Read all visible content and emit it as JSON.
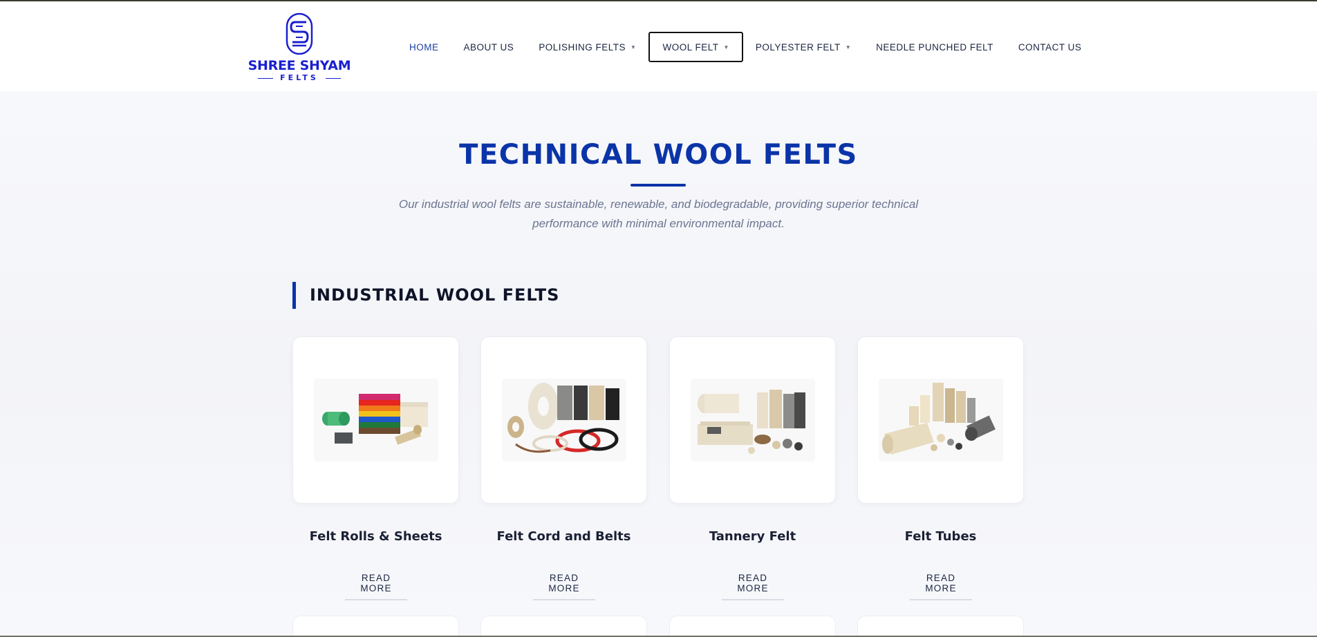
{
  "brand": {
    "name": "SHREE SHYAM",
    "tagline": "FELTS",
    "color": "#1a1fd0"
  },
  "nav": {
    "items": [
      {
        "label": "HOME",
        "active": true,
        "dropdown": false
      },
      {
        "label": "ABOUT US",
        "active": false,
        "dropdown": false
      },
      {
        "label": "POLISHING FELTS",
        "active": false,
        "dropdown": true
      },
      {
        "label": "WOOL FELT",
        "active": false,
        "dropdown": true,
        "focused": true
      },
      {
        "label": "POLYESTER FELT",
        "active": false,
        "dropdown": true
      },
      {
        "label": "NEEDLE PUNCHED FELT",
        "active": false,
        "dropdown": false
      },
      {
        "label": "CONTACT US",
        "active": false,
        "dropdown": false
      }
    ],
    "caret": "▼"
  },
  "hero": {
    "title": "TECHNICAL WOOL FELTS",
    "intro_line1": "Our industrial wool felts are sustainable, renewable, and biodegradable, providing superior technical",
    "intro_line2": "performance with minimal environmental impact."
  },
  "section": {
    "title": "INDUSTRIAL WOOL FELTS"
  },
  "products": [
    {
      "title": "Felt Rolls & Sheets",
      "cta": "READ MORE",
      "image": "felt-rolls-sheets-image"
    },
    {
      "title": "Felt Cord and Belts",
      "cta": "READ MORE",
      "image": "felt-cord-belts-image"
    },
    {
      "title": "Tannery Felt",
      "cta": "READ MORE",
      "image": "tannery-felt-image"
    },
    {
      "title": "Felt Tubes",
      "cta": "READ MORE",
      "image": "felt-tubes-image"
    }
  ],
  "colors": {
    "accent": "#0b34a8",
    "text_dark": "#1a2033",
    "muted": "#6b7490"
  }
}
